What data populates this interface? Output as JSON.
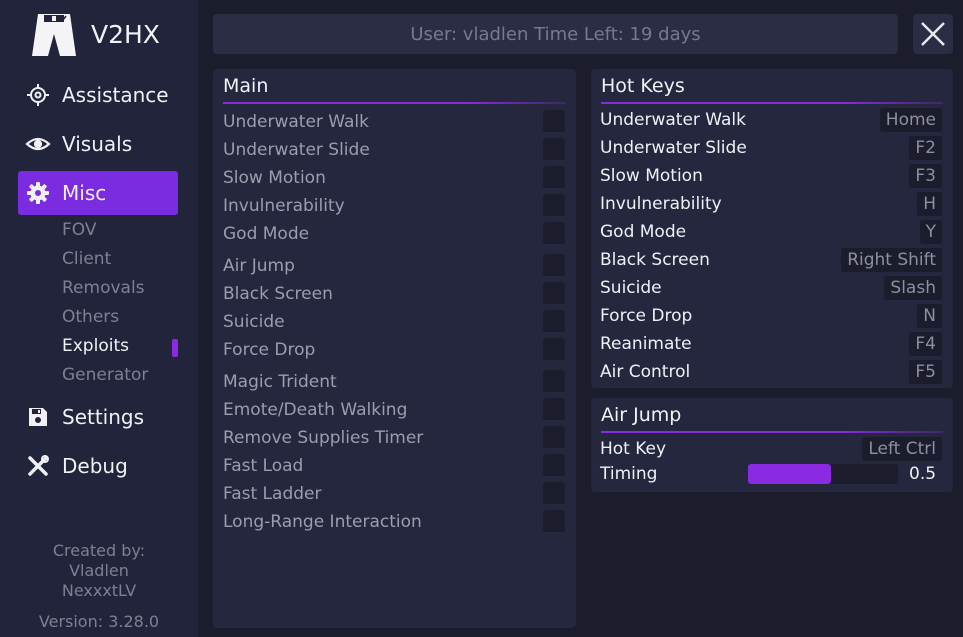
{
  "app": {
    "title": "V2HX"
  },
  "nav": {
    "items": [
      {
        "label": "Assistance",
        "icon": "crosshair-icon"
      },
      {
        "label": "Visuals",
        "icon": "eye-icon"
      },
      {
        "label": "Misc",
        "icon": "gear-icon",
        "active": true
      },
      {
        "label": "Settings",
        "icon": "save-icon"
      },
      {
        "label": "Debug",
        "icon": "tools-icon"
      }
    ],
    "sub_items": [
      {
        "label": "FOV"
      },
      {
        "label": "Client"
      },
      {
        "label": "Removals"
      },
      {
        "label": "Others"
      },
      {
        "label": "Exploits",
        "active": true
      },
      {
        "label": "Generator"
      }
    ]
  },
  "credits": {
    "line1": "Created by:",
    "line2": "Vladlen",
    "line3": "NexxxtLV",
    "version": "Version: 3.28.0"
  },
  "header": {
    "user_text": "User: vladlen Time Left: 19 days"
  },
  "main_panel": {
    "title": "Main",
    "items": [
      "Underwater Walk",
      "Underwater Slide",
      "Slow Motion",
      "Invulnerability",
      "God Mode",
      "Air Jump",
      "Black Screen",
      "Suicide",
      "Force Drop",
      "Magic Trident",
      "Emote/Death Walking",
      "Remove Supplies Timer",
      "Fast Load",
      "Fast Ladder",
      "Long-Range Interaction"
    ]
  },
  "hotkeys_panel": {
    "title": "Hot Keys",
    "items": [
      {
        "label": "Underwater Walk",
        "key": "Home"
      },
      {
        "label": "Underwater Slide",
        "key": "F2"
      },
      {
        "label": "Slow Motion",
        "key": "F3"
      },
      {
        "label": "Invulnerability",
        "key": "H"
      },
      {
        "label": "God Mode",
        "key": "Y"
      },
      {
        "label": "Black Screen",
        "key": "Right Shift"
      },
      {
        "label": "Suicide",
        "key": "Slash"
      },
      {
        "label": "Force Drop",
        "key": "N"
      },
      {
        "label": "Reanimate",
        "key": "F4"
      },
      {
        "label": "Air Control",
        "key": "F5"
      }
    ]
  },
  "airjump_panel": {
    "title": "Air Jump",
    "hotkey_label": "Hot Key",
    "hotkey_value": "Left Ctrl",
    "timing_label": "Timing",
    "timing_value": "0.5",
    "timing_fraction": 0.55
  },
  "colors": {
    "accent": "#8a2be2",
    "background": "#1b1d2c",
    "panel": "#24273d",
    "sidebar": "#21243a"
  }
}
